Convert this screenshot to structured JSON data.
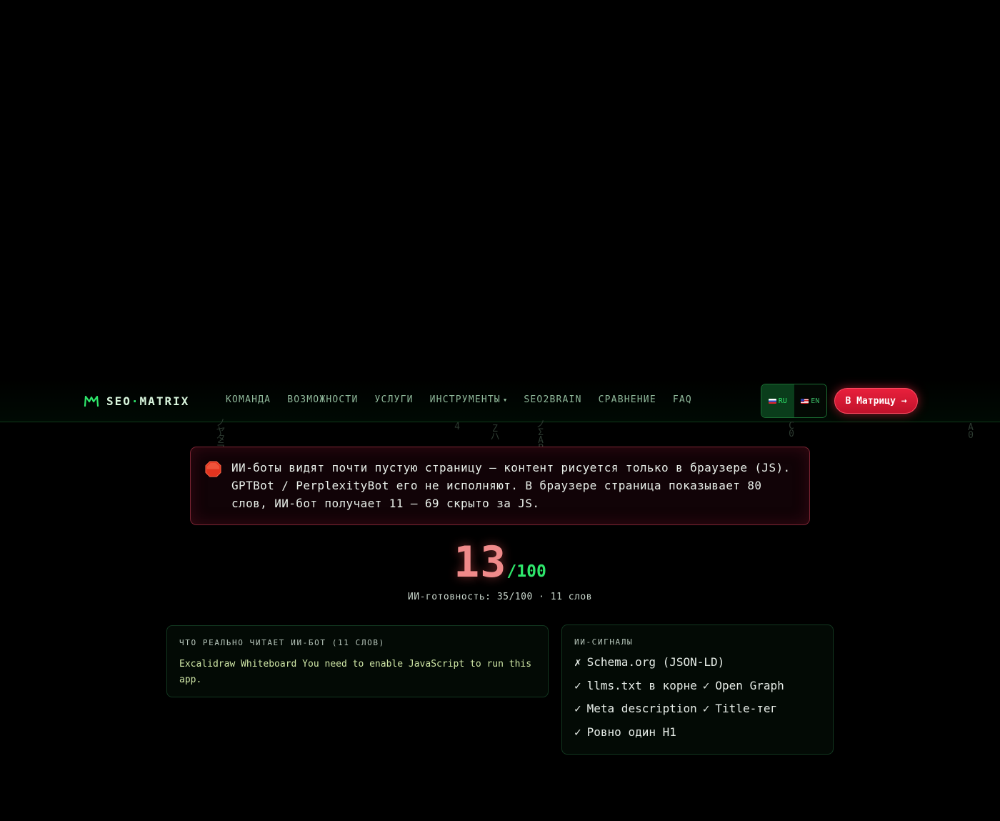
{
  "header": {
    "logo_left": "SEO",
    "logo_dot": "·",
    "logo_right": "MATRIX",
    "menu": [
      {
        "label": "КОМАНДА"
      },
      {
        "label": "ВОЗМОЖНОСТИ"
      },
      {
        "label": "УСЛУГИ"
      },
      {
        "label": "ИНСТРУМЕНТЫ"
      },
      {
        "label": "SEO2BRAIN"
      },
      {
        "label": "СРАВНЕНИЕ"
      },
      {
        "label": "FAQ"
      }
    ],
    "lang_ru": "RU",
    "lang_en": "EN",
    "cta": "В Матрицу →",
    "colors": {
      "accent": "#2ee66b",
      "cta": "#d8163a"
    }
  },
  "alert": {
    "icon": "stop-sign-icon",
    "text": "ИИ-боты видят почти пустую страницу — контент рисуется только в браузере (JS). GPTBot / PerplexityBot его не исполняют. В браузере страница показывает 80 слов, ИИ-бот получает 11 — 69 скрыто за JS."
  },
  "score": {
    "value": "13",
    "max": "/100",
    "caption": "ИИ-готовность: 35/100 · 11 слов"
  },
  "bot_card": {
    "title": "ЧТО РЕАЛЬНО ЧИТАЕТ ИИ-БОТ (11 СЛОВ)",
    "text": "Excalidraw Whiteboard You need to enable JavaScript to run this app."
  },
  "signals_card": {
    "title": "ИИ-СИГНАЛЫ",
    "rows": [
      [
        {
          "mark": "✗",
          "label": "Schema.org (JSON-LD)"
        }
      ],
      [
        {
          "mark": "✓",
          "label": "llms.txt в корне"
        },
        {
          "mark": "✓",
          "label": "Open Graph"
        }
      ],
      [
        {
          "mark": "✓",
          "label": "Meta description"
        },
        {
          "mark": "✓",
          "label": "Title-тег"
        }
      ],
      [
        {
          "mark": "✓",
          "label": "Ровно один H1"
        }
      ]
    ]
  },
  "rain": [
    "ノ\nヤ\nタ\nラ",
    "4",
    "Z\nハ",
    "ノ\nΣ\nA\nP",
    "C\n0",
    "A\n0"
  ]
}
